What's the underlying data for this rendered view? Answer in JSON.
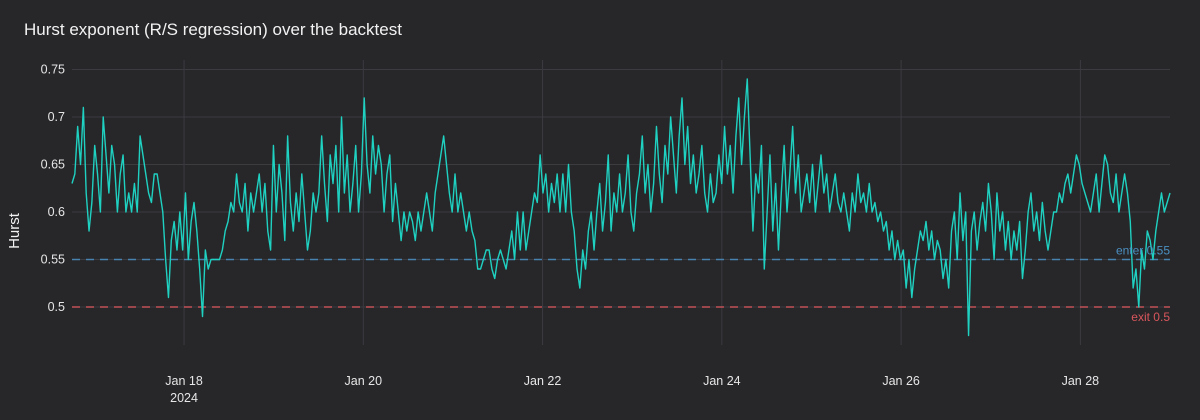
{
  "chart_data": {
    "type": "line",
    "title": "Hurst exponent (R/S regression) over the backtest",
    "xlabel": "",
    "ylabel": "Hurst",
    "x_start": "2024-01-16T18:00",
    "x_end": "2024-01-29T00:00",
    "xlim": [
      "2024-01-16T18:00",
      "2024-01-29T00:00"
    ],
    "ylim": [
      0.46,
      0.76
    ],
    "x_ticks": [
      {
        "date": "2024-01-18",
        "label": "Jan 18",
        "sublabel": "2024"
      },
      {
        "date": "2024-01-20",
        "label": "Jan 20",
        "sublabel": ""
      },
      {
        "date": "2024-01-22",
        "label": "Jan 22",
        "sublabel": ""
      },
      {
        "date": "2024-01-24",
        "label": "Jan 24",
        "sublabel": ""
      },
      {
        "date": "2024-01-26",
        "label": "Jan 26",
        "sublabel": ""
      },
      {
        "date": "2024-01-28",
        "label": "Jan 28",
        "sublabel": ""
      }
    ],
    "y_ticks": [
      {
        "value": 0.5,
        "label": "0.5"
      },
      {
        "value": 0.55,
        "label": "0.55"
      },
      {
        "value": 0.6,
        "label": "0.6"
      },
      {
        "value": 0.65,
        "label": "0.65"
      },
      {
        "value": 0.7,
        "label": "0.7"
      },
      {
        "value": 0.75,
        "label": "0.75"
      }
    ],
    "grid": true,
    "legend": "none",
    "series": [
      {
        "color": "#1fd1c1",
        "values": [
          0.63,
          0.64,
          0.69,
          0.65,
          0.71,
          0.62,
          0.58,
          0.61,
          0.67,
          0.64,
          0.6,
          0.7,
          0.66,
          0.62,
          0.67,
          0.65,
          0.6,
          0.64,
          0.66,
          0.6,
          0.62,
          0.6,
          0.63,
          0.6,
          0.68,
          0.66,
          0.64,
          0.62,
          0.61,
          0.64,
          0.64,
          0.62,
          0.6,
          0.55,
          0.51,
          0.57,
          0.59,
          0.56,
          0.6,
          0.56,
          0.62,
          0.55,
          0.59,
          0.61,
          0.58,
          0.54,
          0.49,
          0.56,
          0.54,
          0.55,
          0.55,
          0.55,
          0.55,
          0.56,
          0.58,
          0.59,
          0.61,
          0.6,
          0.64,
          0.61,
          0.6,
          0.63,
          0.58,
          0.62,
          0.6,
          0.62,
          0.64,
          0.6,
          0.63,
          0.58,
          0.56,
          0.67,
          0.6,
          0.65,
          0.62,
          0.57,
          0.68,
          0.61,
          0.58,
          0.62,
          0.59,
          0.64,
          0.6,
          0.56,
          0.58,
          0.62,
          0.6,
          0.62,
          0.68,
          0.63,
          0.59,
          0.66,
          0.63,
          0.67,
          0.6,
          0.7,
          0.62,
          0.66,
          0.6,
          0.63,
          0.67,
          0.6,
          0.64,
          0.72,
          0.65,
          0.62,
          0.68,
          0.64,
          0.67,
          0.65,
          0.6,
          0.64,
          0.66,
          0.59,
          0.63,
          0.6,
          0.57,
          0.6,
          0.58,
          0.6,
          0.59,
          0.57,
          0.6,
          0.58,
          0.6,
          0.62,
          0.6,
          0.58,
          0.62,
          0.64,
          0.66,
          0.68,
          0.65,
          0.62,
          0.6,
          0.64,
          0.6,
          0.62,
          0.6,
          0.58,
          0.6,
          0.58,
          0.57,
          0.54,
          0.54,
          0.55,
          0.56,
          0.56,
          0.54,
          0.53,
          0.55,
          0.56,
          0.55,
          0.54,
          0.56,
          0.58,
          0.55,
          0.6,
          0.56,
          0.6,
          0.56,
          0.58,
          0.6,
          0.62,
          0.61,
          0.66,
          0.62,
          0.64,
          0.6,
          0.63,
          0.61,
          0.64,
          0.6,
          0.64,
          0.6,
          0.65,
          0.6,
          0.58,
          0.54,
          0.52,
          0.56,
          0.54,
          0.58,
          0.6,
          0.56,
          0.6,
          0.63,
          0.58,
          0.61,
          0.66,
          0.58,
          0.62,
          0.6,
          0.64,
          0.6,
          0.62,
          0.66,
          0.6,
          0.58,
          0.62,
          0.64,
          0.68,
          0.62,
          0.65,
          0.6,
          0.63,
          0.69,
          0.64,
          0.61,
          0.67,
          0.64,
          0.7,
          0.66,
          0.62,
          0.68,
          0.72,
          0.65,
          0.69,
          0.63,
          0.66,
          0.62,
          0.64,
          0.67,
          0.62,
          0.6,
          0.64,
          0.61,
          0.62,
          0.66,
          0.63,
          0.69,
          0.64,
          0.67,
          0.62,
          0.68,
          0.72,
          0.65,
          0.7,
          0.74,
          0.66,
          0.58,
          0.64,
          0.62,
          0.67,
          0.54,
          0.6,
          0.66,
          0.58,
          0.63,
          0.56,
          0.62,
          0.67,
          0.6,
          0.64,
          0.69,
          0.62,
          0.66,
          0.6,
          0.62,
          0.64,
          0.61,
          0.65,
          0.6,
          0.63,
          0.66,
          0.62,
          0.64,
          0.6,
          0.62,
          0.64,
          0.61,
          0.6,
          0.62,
          0.6,
          0.58,
          0.62,
          0.6,
          0.64,
          0.61,
          0.62,
          0.6,
          0.63,
          0.6,
          0.61,
          0.59,
          0.6,
          0.58,
          0.59,
          0.56,
          0.58,
          0.55,
          0.57,
          0.55,
          0.56,
          0.52,
          0.55,
          0.51,
          0.54,
          0.56,
          0.58,
          0.57,
          0.59,
          0.56,
          0.58,
          0.55,
          0.57,
          0.56,
          0.53,
          0.55,
          0.52,
          0.58,
          0.6,
          0.55,
          0.62,
          0.57,
          0.6,
          0.47,
          0.58,
          0.6,
          0.56,
          0.59,
          0.61,
          0.58,
          0.63,
          0.6,
          0.55,
          0.62,
          0.58,
          0.6,
          0.56,
          0.59,
          0.55,
          0.58,
          0.56,
          0.59,
          0.53,
          0.56,
          0.6,
          0.62,
          0.58,
          0.6,
          0.57,
          0.61,
          0.58,
          0.56,
          0.58,
          0.6,
          0.6,
          0.62,
          0.61,
          0.63,
          0.64,
          0.62,
          0.64,
          0.66,
          0.65,
          0.63,
          0.62,
          0.61,
          0.6,
          0.62,
          0.64,
          0.6,
          0.63,
          0.66,
          0.65,
          0.62,
          0.61,
          0.64,
          0.6,
          0.62,
          0.64,
          0.62,
          0.59,
          0.52,
          0.54,
          0.5,
          0.56,
          0.54,
          0.58,
          0.57,
          0.55,
          0.58,
          0.6,
          0.62,
          0.6,
          0.61,
          0.62
        ]
      }
    ],
    "reference_lines": [
      {
        "value": 0.55,
        "label": "enter 0.55",
        "color": "#4a90c2"
      },
      {
        "value": 0.5,
        "label": "exit 0.5",
        "color": "#d9565c"
      }
    ]
  }
}
